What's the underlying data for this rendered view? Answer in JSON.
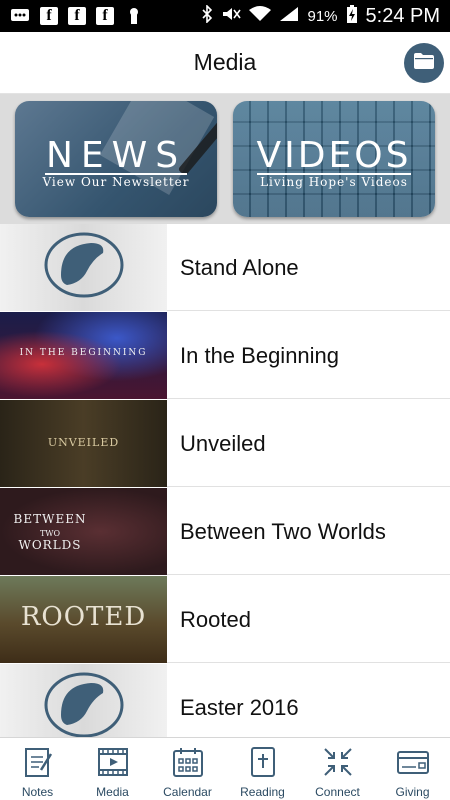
{
  "status_bar": {
    "battery": "91%",
    "time": "5:24 PM"
  },
  "header": {
    "title": "Media"
  },
  "banner": {
    "news": {
      "title": "NEWS",
      "subtitle": "View Our Newsletter"
    },
    "videos": {
      "title": "VIDEOS",
      "subtitle": "Living Hope's Videos"
    }
  },
  "list": {
    "items": [
      {
        "label": "Stand Alone",
        "thumb": "logo"
      },
      {
        "label": "In the Beginning",
        "thumb": "genesis",
        "thumb_text": "IN THE BEGINNING"
      },
      {
        "label": "Unveiled",
        "thumb": "unveiled",
        "thumb_text": "UNVEILED"
      },
      {
        "label": "Between Two Worlds",
        "thumb": "between",
        "thumb_text_1": "BETWEEN",
        "thumb_text_2": "TWO",
        "thumb_text_3": "WORLDS"
      },
      {
        "label": "Rooted",
        "thumb": "rooted",
        "thumb_text": "ROOTED"
      },
      {
        "label": "Easter 2016",
        "thumb": "logo"
      }
    ]
  },
  "tabbar": {
    "tabs": [
      {
        "label": "Notes",
        "icon": "notes-icon"
      },
      {
        "label": "Media",
        "icon": "media-icon"
      },
      {
        "label": "Calendar",
        "icon": "calendar-icon"
      },
      {
        "label": "Reading",
        "icon": "bible-icon"
      },
      {
        "label": "Connect",
        "icon": "connect-icon"
      },
      {
        "label": "Giving",
        "icon": "giving-icon"
      }
    ]
  },
  "colors": {
    "accent": "#3f5f78",
    "tab_text": "#2b4a62"
  }
}
